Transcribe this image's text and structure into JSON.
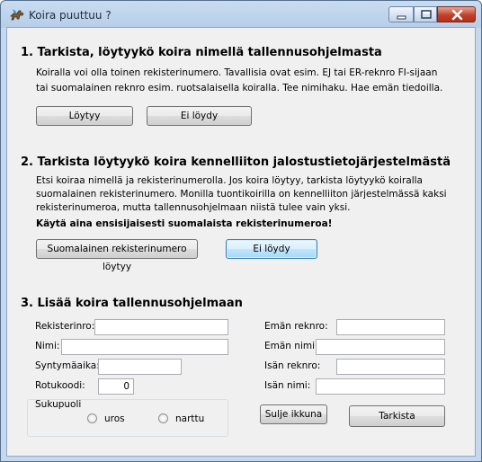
{
  "window": {
    "title": "Koira puuttuu ?"
  },
  "section1": {
    "heading": "1. Tarkista, löytyykö koira nimellä tallennusohjelmasta",
    "line1": "Koiralla voi olla toinen rekisterinumero. Tavallisia ovat esim. EJ tai ER-reknro FI-sijaan",
    "line2": "tai suomalainen reknro esim. ruotsalaisella koiralla. Tee nimihaku. Hae emän tiedoilla.",
    "found_button": "Löytyy",
    "not_found_button": "Ei löydy"
  },
  "section2": {
    "heading": "2. Tarkista löytyykö koira kennelliiton jalostustietojärjestelmästä",
    "line1": "Etsi koiraa nimellä ja rekisterinumerolla. Jos koira löytyy, tarkista löytyykö koiralla",
    "line2": "suomalainen rekisterinumero. Monilla tuontikoirilla on kennelliiton järjestelmässä kaksi",
    "line3": "rekisterinumeroa, mutta tallennusohjelmaan niistä tulee vain yksi.",
    "bold_line": "Käytä aina ensisijaisesti suomalaista rekisterinumeroa!",
    "found_button": "Suomalainen rekisterinumero löytyy",
    "not_found_button": "Ei löydy"
  },
  "section3": {
    "heading": "3. Lisää koira tallennusohjelmaan",
    "regno_label": "Rekisterinro:",
    "regno_value": "",
    "name_label": "Nimi:",
    "name_value": "",
    "birth_label": "Syntymäaika:",
    "birth_value": "",
    "breed_label": "Rotukoodi:",
    "breed_value": "0",
    "sex_label": "Sukupuoli",
    "male_label": "uros",
    "female_label": "narttu",
    "dam_regno_label": "Emän reknro:",
    "dam_regno_value": "",
    "dam_name_label": "Emän nimi:",
    "dam_name_value": "",
    "sire_regno_label": "Isän reknro:",
    "sire_regno_value": "",
    "sire_name_label": "Isän nimi:",
    "sire_name_value": "",
    "close_button": "Sulje ikkuna",
    "check_button": "Tarkista"
  },
  "icon_names": [
    "dog-app-icon",
    "minimize-icon",
    "maximize-icon",
    "close-icon"
  ]
}
